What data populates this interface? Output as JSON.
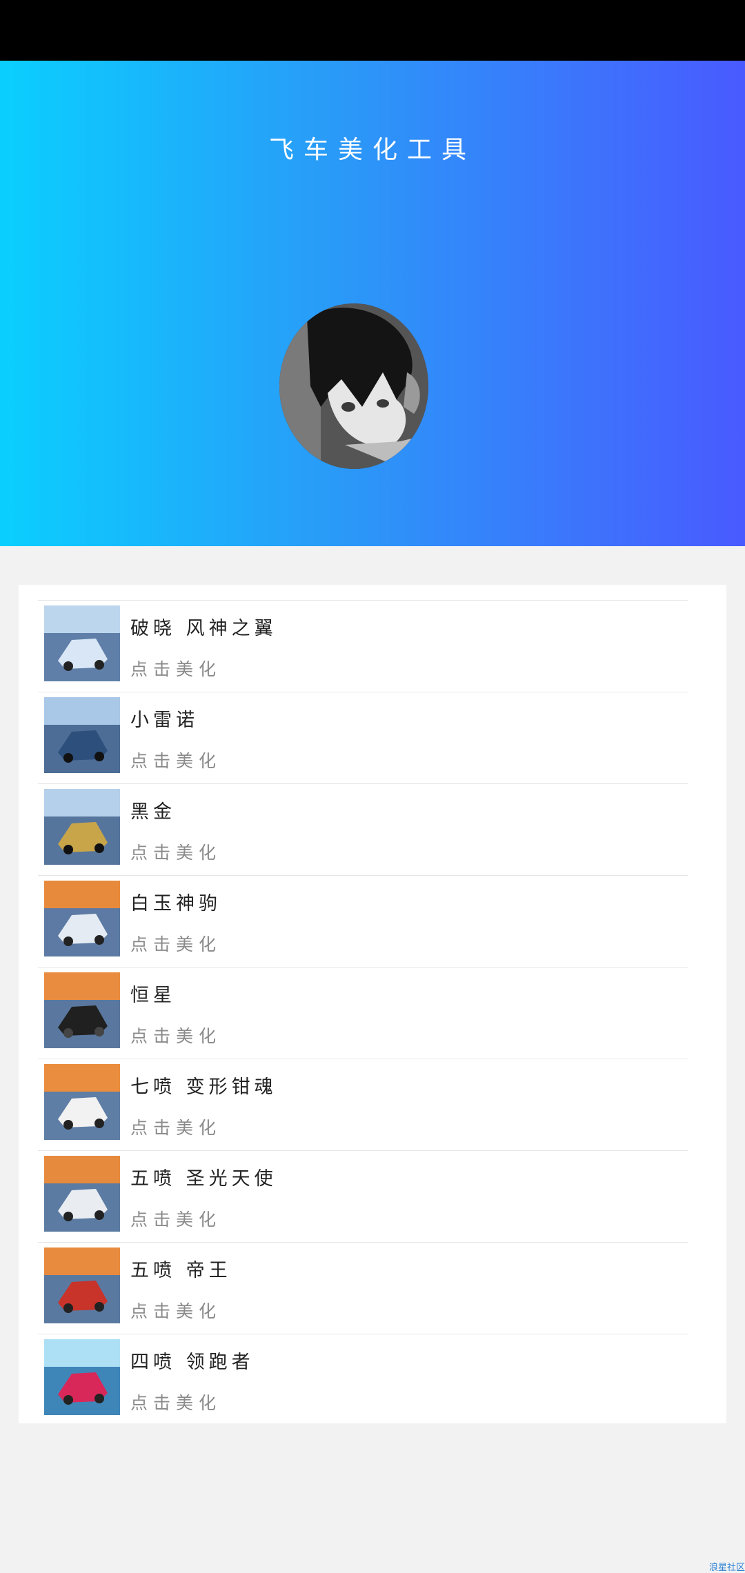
{
  "header": {
    "title": "飞车美化工具",
    "gradient_start": "#0acffe",
    "gradient_end": "#495aff"
  },
  "list": {
    "items": [
      {
        "title": "破晓 风神之翼",
        "subtitle": "点击美化",
        "icon": "kart-thumbnail",
        "color": "#d8e6f5"
      },
      {
        "title": "小雷诺",
        "subtitle": "点击美化",
        "icon": "kart-thumbnail",
        "color": "#2d4f7c"
      },
      {
        "title": "黑金",
        "subtitle": "点击美化",
        "icon": "kart-thumbnail",
        "color": "#c9a54a"
      },
      {
        "title": "白玉神驹",
        "subtitle": "点击美化",
        "icon": "kart-thumbnail",
        "color": "#e4ebf2"
      },
      {
        "title": "恒星",
        "subtitle": "点击美化",
        "icon": "kart-thumbnail",
        "color": "#202020"
      },
      {
        "title": "七喷 变形钳魂",
        "subtitle": "点击美化",
        "icon": "kart-thumbnail",
        "color": "#f2f2f2"
      },
      {
        "title": "五喷 圣光天使",
        "subtitle": "点击美化",
        "icon": "kart-thumbnail",
        "color": "#e9edf2"
      },
      {
        "title": "五喷 帝王",
        "subtitle": "点击美化",
        "icon": "kart-thumbnail",
        "color": "#c8332a"
      },
      {
        "title": "四喷 领跑者",
        "subtitle": "点击美化",
        "icon": "kart-thumbnail",
        "color": "#d8285a"
      }
    ]
  },
  "watermark": "浪星社区"
}
